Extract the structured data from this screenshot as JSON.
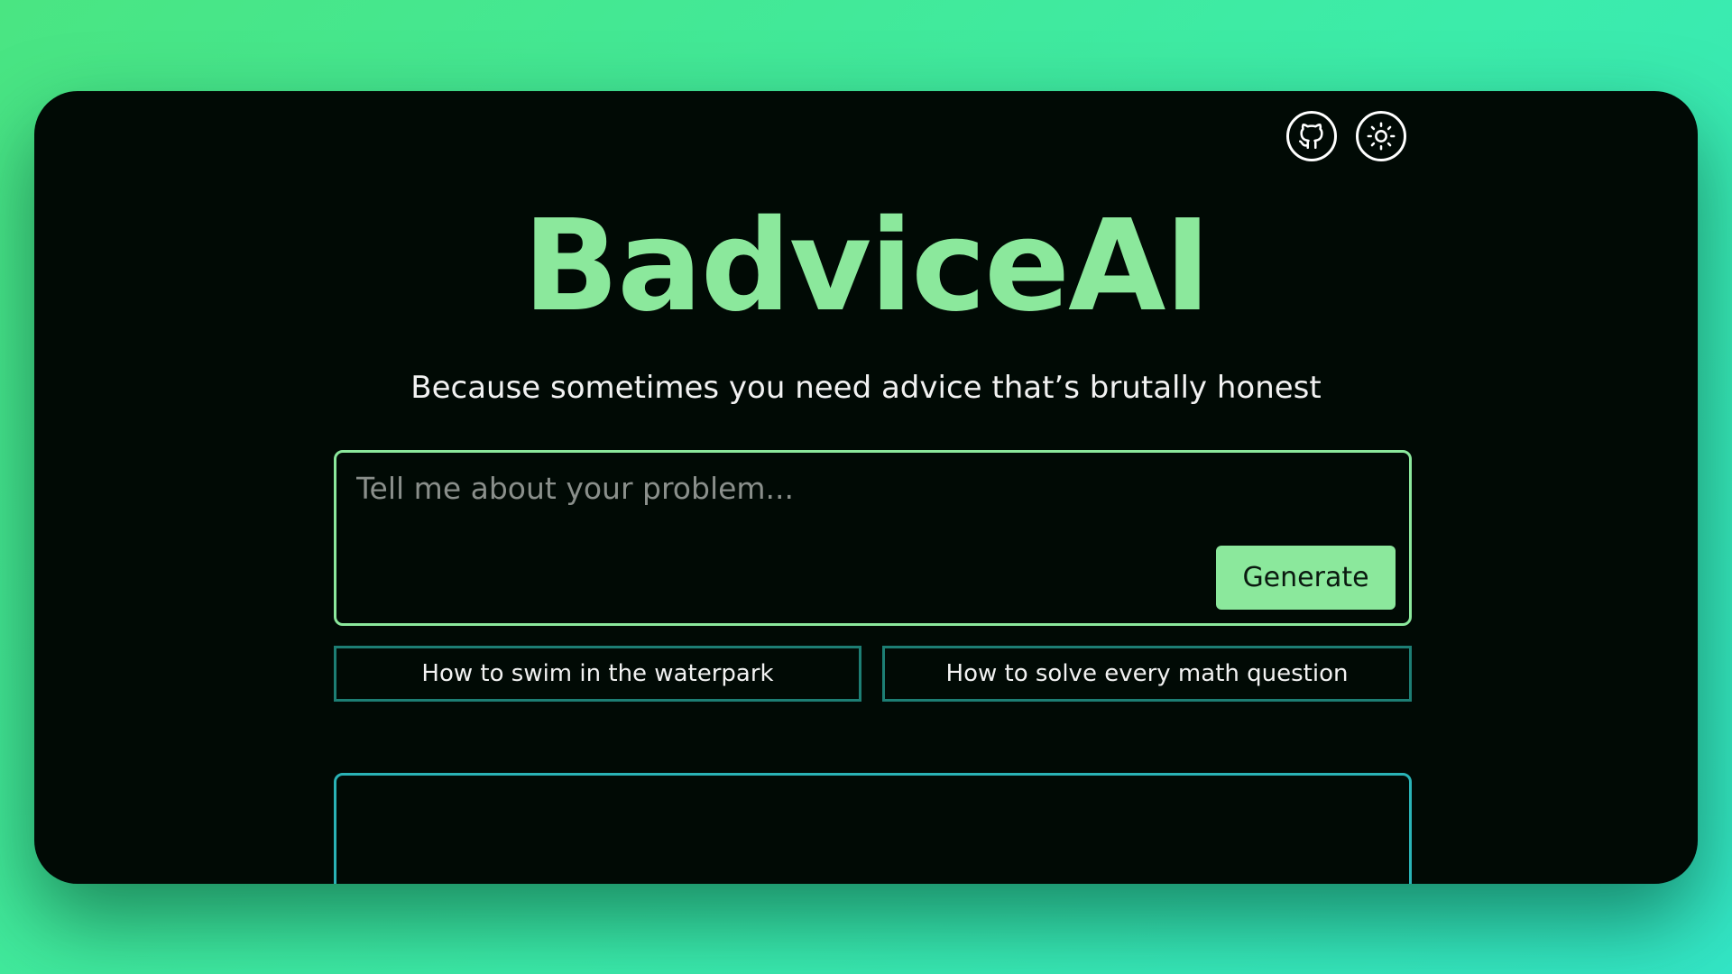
{
  "header": {
    "github_icon": "github-icon",
    "theme_icon": "sun-icon"
  },
  "hero": {
    "title": "BadviceAI",
    "subtitle": "Because sometimes you need advice that’s brutally honest"
  },
  "prompt": {
    "placeholder": "Tell me about your problem...",
    "value": "",
    "generate_label": "Generate"
  },
  "suggestions": [
    {
      "label": "How to swim in the waterpark"
    },
    {
      "label": "How to solve every math question"
    }
  ],
  "output": {
    "text": ""
  },
  "colors": {
    "accent": "#8be89c",
    "background": "#010a05",
    "suggestion_border": "#1d7e74",
    "output_border": "#2ab3b6"
  }
}
